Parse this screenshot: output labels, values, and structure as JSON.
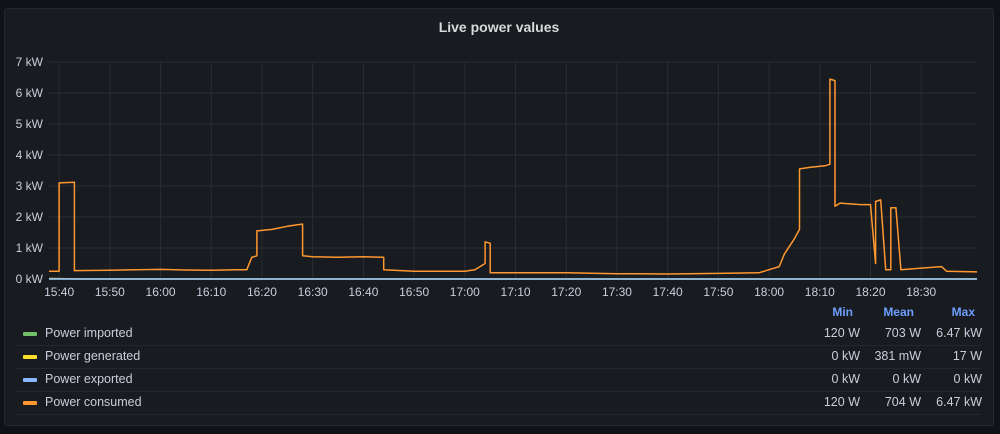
{
  "panel": {
    "title": "Live power values"
  },
  "legend": {
    "headers": {
      "min": "Min",
      "mean": "Mean",
      "max": "Max"
    },
    "rows": [
      {
        "name": "Power imported",
        "color": "#73bf69",
        "min": "120 W",
        "mean": "703 W",
        "max": "6.47 kW"
      },
      {
        "name": "Power generated",
        "color": "#fade2a",
        "min": "0 kW",
        "mean": "381 mW",
        "max": "17 W"
      },
      {
        "name": "Power exported",
        "color": "#8ab8ff",
        "min": "0 kW",
        "mean": "0 kW",
        "max": "0 kW"
      },
      {
        "name": "Power consumed",
        "color": "#ff9830",
        "min": "120 W",
        "mean": "704 W",
        "max": "6.47 kW"
      }
    ]
  },
  "chart_data": {
    "type": "line",
    "title": "Live power values",
    "x_ticks": [
      "15:40",
      "15:50",
      "16:00",
      "16:10",
      "16:20",
      "16:30",
      "16:40",
      "16:50",
      "17:00",
      "17:10",
      "17:20",
      "17:30",
      "17:40",
      "17:50",
      "18:00",
      "18:10",
      "18:20",
      "18:30"
    ],
    "y_ticks": [
      "0 kW",
      "1 kW",
      "2 kW",
      "3 kW",
      "4 kW",
      "5 kW",
      "6 kW",
      "7 kW"
    ],
    "ylim": [
      0,
      7000
    ],
    "xlim": [
      "15:38",
      "18:41"
    ],
    "grid": true,
    "legend_placement": "bottom",
    "series": [
      {
        "name": "Power consumed",
        "color": "#ff9830",
        "points": [
          [
            "15:38",
            250
          ],
          [
            "15:40",
            250
          ],
          [
            "15:40",
            3100
          ],
          [
            "15:43",
            3120
          ],
          [
            "15:43",
            270
          ],
          [
            "15:50",
            280
          ],
          [
            "15:55",
            300
          ],
          [
            "16:00",
            310
          ],
          [
            "16:05",
            290
          ],
          [
            "16:10",
            280
          ],
          [
            "16:15",
            300
          ],
          [
            "16:17",
            300
          ],
          [
            "16:18",
            700
          ],
          [
            "16:19",
            750
          ],
          [
            "16:19",
            1550
          ],
          [
            "16:22",
            1600
          ],
          [
            "16:25",
            1700
          ],
          [
            "16:27",
            1750
          ],
          [
            "16:28",
            1770
          ],
          [
            "16:28",
            750
          ],
          [
            "16:30",
            720
          ],
          [
            "16:35",
            700
          ],
          [
            "16:40",
            720
          ],
          [
            "16:44",
            700
          ],
          [
            "16:44",
            300
          ],
          [
            "16:50",
            250
          ],
          [
            "17:00",
            250
          ],
          [
            "17:02",
            300
          ],
          [
            "17:03",
            400
          ],
          [
            "17:04",
            500
          ],
          [
            "17:04",
            1200
          ],
          [
            "17:05",
            1150
          ],
          [
            "17:05",
            200
          ],
          [
            "17:10",
            200
          ],
          [
            "17:20",
            200
          ],
          [
            "17:30",
            170
          ],
          [
            "17:40",
            160
          ],
          [
            "17:50",
            180
          ],
          [
            "17:58",
            200
          ],
          [
            "18:00",
            300
          ],
          [
            "18:02",
            400
          ],
          [
            "18:03",
            800
          ],
          [
            "18:05",
            1300
          ],
          [
            "18:06",
            1600
          ],
          [
            "18:06",
            3550
          ],
          [
            "18:08",
            3600
          ],
          [
            "18:11",
            3650
          ],
          [
            "18:12",
            3700
          ],
          [
            "18:12",
            6450
          ],
          [
            "18:13",
            6400
          ],
          [
            "18:13",
            2350
          ],
          [
            "18:14",
            2450
          ],
          [
            "18:18",
            2400
          ],
          [
            "18:20",
            2400
          ],
          [
            "18:21",
            500
          ],
          [
            "18:21",
            2500
          ],
          [
            "18:22",
            2550
          ],
          [
            "18:23",
            300
          ],
          [
            "18:24",
            300
          ],
          [
            "18:24",
            2300
          ],
          [
            "18:25",
            2300
          ],
          [
            "18:26",
            300
          ],
          [
            "18:30",
            350
          ],
          [
            "18:34",
            400
          ],
          [
            "18:35",
            250
          ],
          [
            "18:41",
            230
          ]
        ]
      },
      {
        "name": "Power imported",
        "color": "#73bf69",
        "points": [
          [
            "15:38",
            0
          ],
          [
            "18:41",
            0
          ]
        ]
      },
      {
        "name": "Power generated",
        "color": "#fade2a",
        "points": [
          [
            "15:38",
            17
          ],
          [
            "15:45",
            0
          ],
          [
            "18:41",
            0
          ]
        ]
      },
      {
        "name": "Power exported",
        "color": "#8ab8ff",
        "points": [
          [
            "15:38",
            0
          ],
          [
            "18:41",
            0
          ]
        ]
      }
    ]
  }
}
